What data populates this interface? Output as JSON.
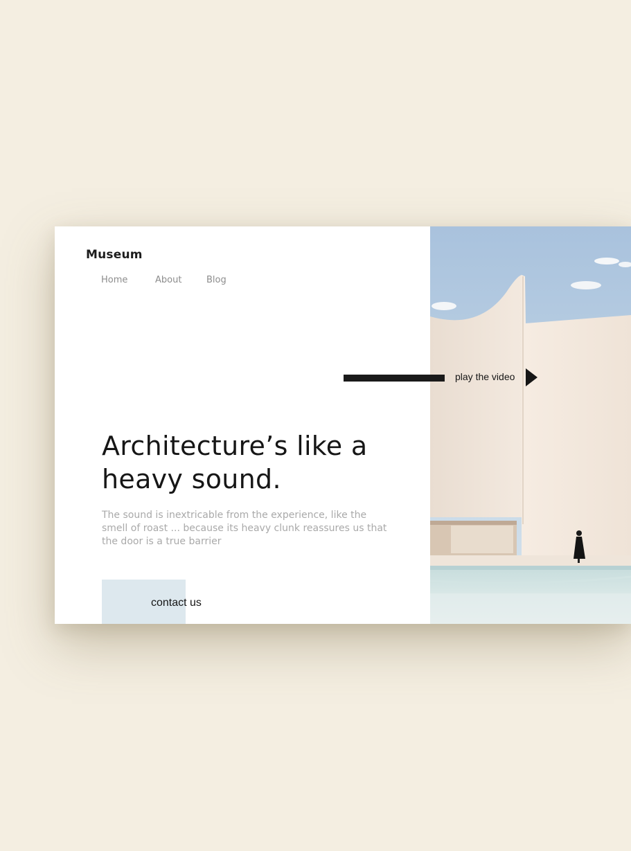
{
  "header": {
    "brand": "Museum",
    "nav": [
      {
        "label": "Home"
      },
      {
        "label": "About"
      },
      {
        "label": "Blog"
      }
    ]
  },
  "hero": {
    "headline_line1": "Architecture’s like a",
    "headline_line2": "heavy sound.",
    "description": "The sound is inextricable from the experience, like the smell of roast ... because its heavy clunk reassures us that the door is a true barrier",
    "contact_label": "contact us"
  },
  "video": {
    "label": "play the video"
  },
  "colors": {
    "page_background": "#f4eee1",
    "card_background": "#ffffff",
    "contact_block": "#dde8ee",
    "text_dark": "#161616",
    "text_muted": "#a9a9a9",
    "nav_text": "#8c8c8c"
  }
}
